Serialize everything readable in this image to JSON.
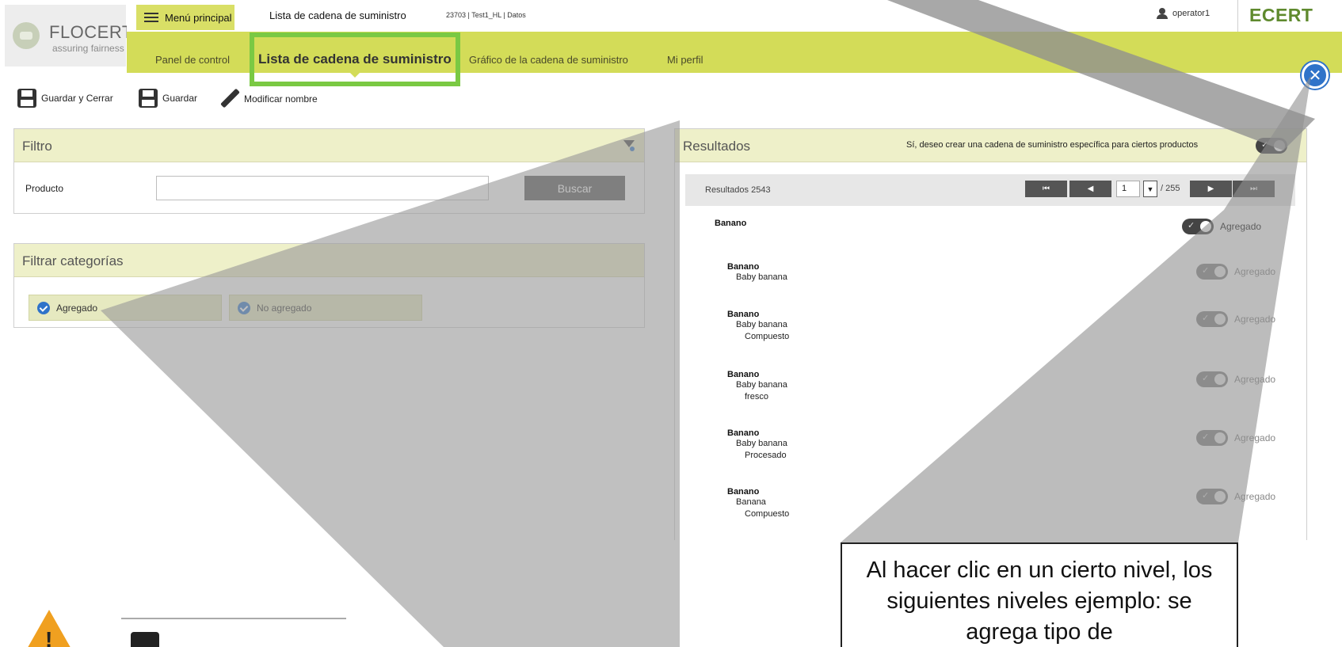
{
  "logo": {
    "name": "FLOCERT",
    "tagline": "assuring fairness"
  },
  "topbar": {
    "menu_label": "Menú principal",
    "page_title": "Lista de cadena de suministro",
    "context": "23703 | Test1_HL | Datos",
    "user": "operator1",
    "brand": "ECERT"
  },
  "nav": {
    "items": [
      {
        "label": "Panel de control"
      },
      {
        "label": "Lista de cadena de suministro",
        "active": true
      },
      {
        "label": "Gráfico de la cadena de suministro"
      },
      {
        "label": "Mi perfil"
      }
    ]
  },
  "toolbar": {
    "save_close": "Guardar y Cerrar",
    "save": "Guardar",
    "rename": "Modificar nombre"
  },
  "filter": {
    "title": "Filtro",
    "product_label": "Producto",
    "product_value": "",
    "search_button": "Buscar"
  },
  "categories": {
    "title": "Filtrar categorías",
    "chips": [
      {
        "label": "Agregado",
        "checked": true
      },
      {
        "label": "No agregado",
        "checked": true
      }
    ]
  },
  "results": {
    "title": "Resultados",
    "specific_chain_label": "Sí, deseo crear una cadena de suministro específica para ciertos productos",
    "count_text": "Resultados 2543",
    "page": "1",
    "total_pages": "/ 255",
    "group_label": "Banano",
    "group_status": "Agregado",
    "rows": [
      {
        "name": "Banano",
        "lines": [
          "Baby banana"
        ],
        "status": "Agregado"
      },
      {
        "name": "Banano",
        "lines": [
          "Baby banana",
          "Compuesto"
        ],
        "status": "Agregado"
      },
      {
        "name": "Banano",
        "lines": [
          "Baby banana",
          "fresco"
        ],
        "status": "Agregado"
      },
      {
        "name": "Banano",
        "lines": [
          "Baby banana",
          "Procesado"
        ],
        "status": "Agregado"
      },
      {
        "name": "Banano",
        "lines": [
          "Banana",
          "Compuesto"
        ],
        "status": "Agregado"
      }
    ]
  },
  "callout": {
    "text": "Al hacer clic en un cierto nivel, los siguientes niveles ejemplo: se agrega tipo de"
  },
  "colors": {
    "nav_bg": "#d3dc58",
    "highlight": "#7ac943",
    "panel_head": "#eef0c9",
    "accent_blue": "#2f73c9",
    "brand_green": "#5f8a2e"
  }
}
